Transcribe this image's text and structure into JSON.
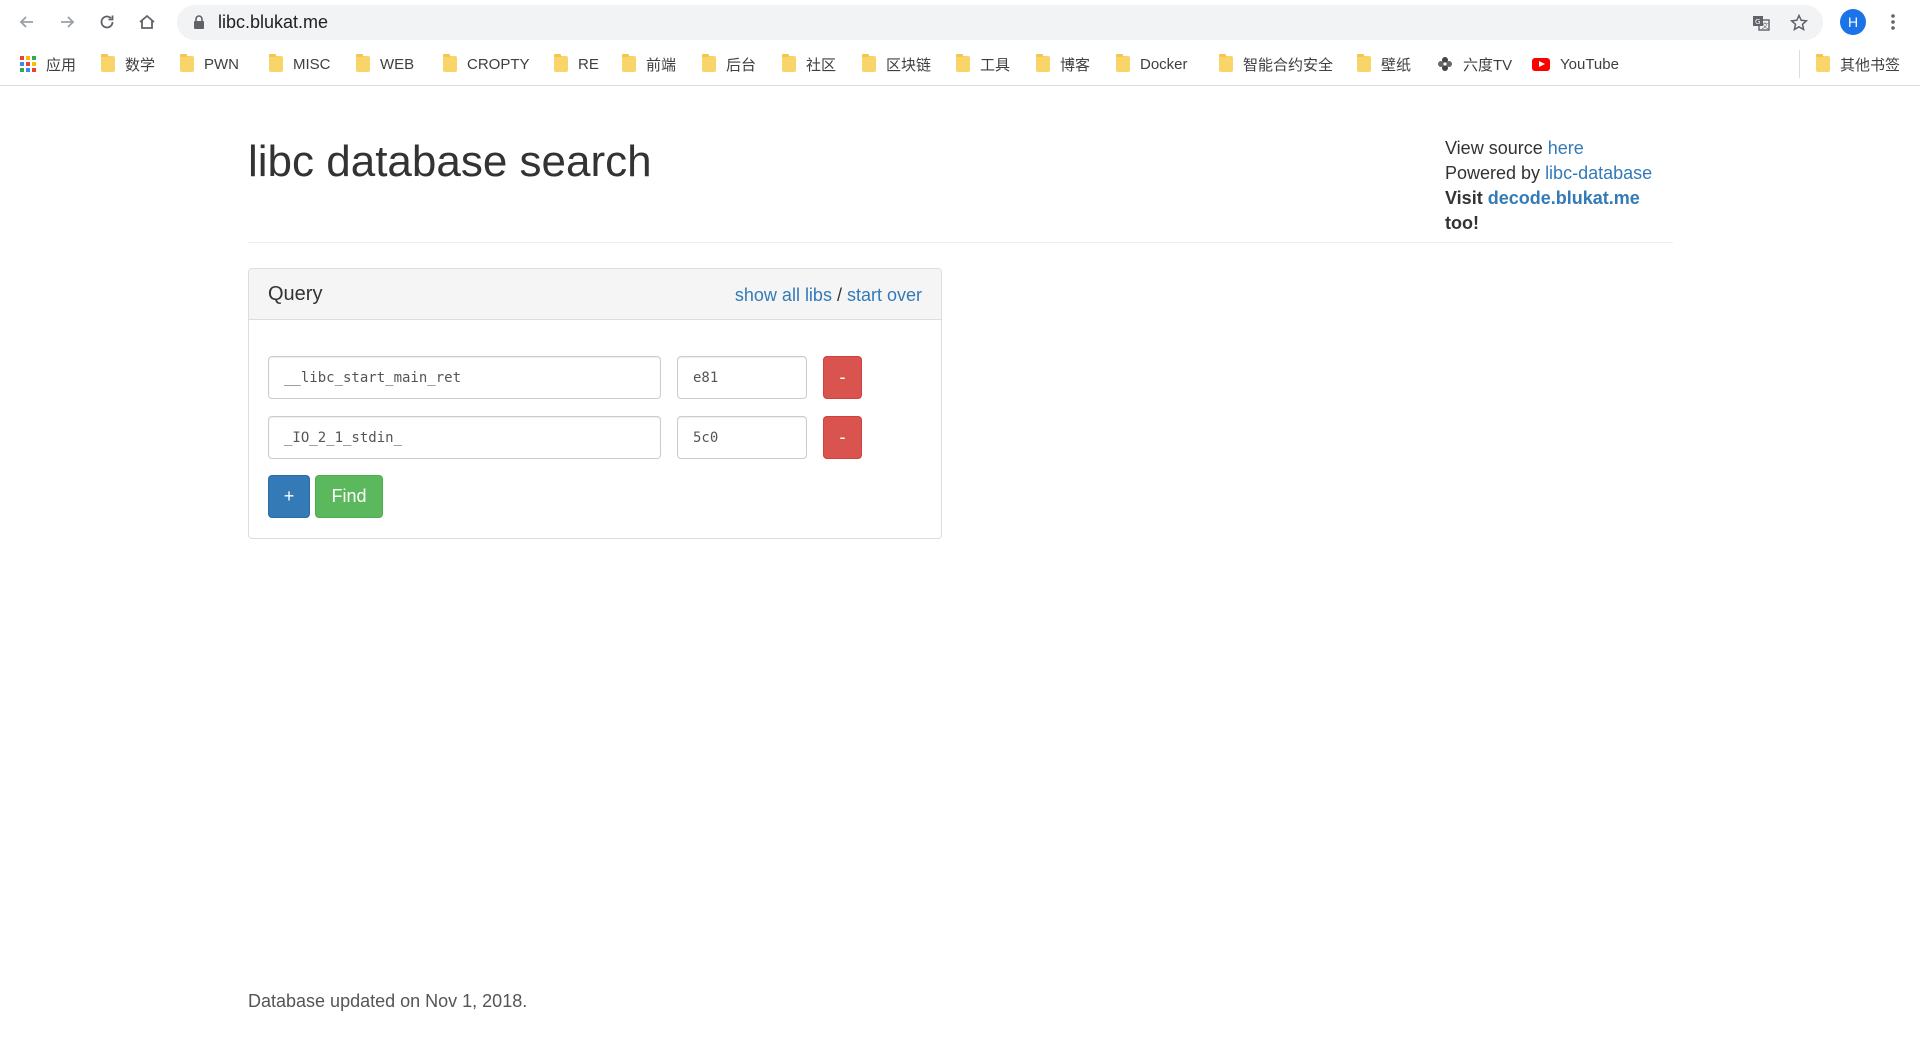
{
  "browser": {
    "url": "libc.blukat.me",
    "avatar_letter": "H",
    "bookmarks": [
      {
        "label": "应用",
        "icon": "apps-grid-icon"
      },
      {
        "label": "数学",
        "icon": "folder-icon"
      },
      {
        "label": "PWN",
        "icon": "folder-icon"
      },
      {
        "label": "MISC",
        "icon": "folder-icon"
      },
      {
        "label": "WEB",
        "icon": "folder-icon"
      },
      {
        "label": "CROPTY",
        "icon": "folder-icon"
      },
      {
        "label": "RE",
        "icon": "folder-icon"
      },
      {
        "label": "前端",
        "icon": "folder-icon"
      },
      {
        "label": "后台",
        "icon": "folder-icon"
      },
      {
        "label": "社区",
        "icon": "folder-icon"
      },
      {
        "label": "区块链",
        "icon": "folder-icon"
      },
      {
        "label": "工具",
        "icon": "folder-icon"
      },
      {
        "label": "博客",
        "icon": "folder-icon"
      },
      {
        "label": "Docker",
        "icon": "folder-icon"
      },
      {
        "label": "智能合约安全",
        "icon": "folder-icon"
      },
      {
        "label": "壁纸",
        "icon": "folder-icon"
      },
      {
        "label": "六度TV",
        "icon": "flower-icon"
      },
      {
        "label": "YouTube",
        "icon": "youtube-icon"
      }
    ],
    "other_bookmarks": "其他书签"
  },
  "header": {
    "title": "libc database search",
    "view_source_prefix": "View source ",
    "view_source_link": "here",
    "powered_prefix": "Powered by ",
    "powered_link": "libc-database",
    "visit_prefix": "Visit ",
    "visit_link": "decode.blukat.me",
    "visit_suffix": " too!"
  },
  "query": {
    "title": "Query",
    "show_all_libs": "show all libs",
    "separator": " / ",
    "start_over": "start over",
    "rows": [
      {
        "symbol": "__libc_start_main_ret",
        "address": "e81",
        "remove_label": "-"
      },
      {
        "symbol": "_IO_2_1_stdin_",
        "address": "5c0",
        "remove_label": "-"
      }
    ],
    "add_label": "+",
    "find_label": "Find"
  },
  "footer": {
    "text": "Database updated on Nov 1, 2018."
  },
  "colors": {
    "link": "#337ab7",
    "danger": "#d9534f",
    "primary": "#337ab7",
    "success": "#5cb85c"
  }
}
